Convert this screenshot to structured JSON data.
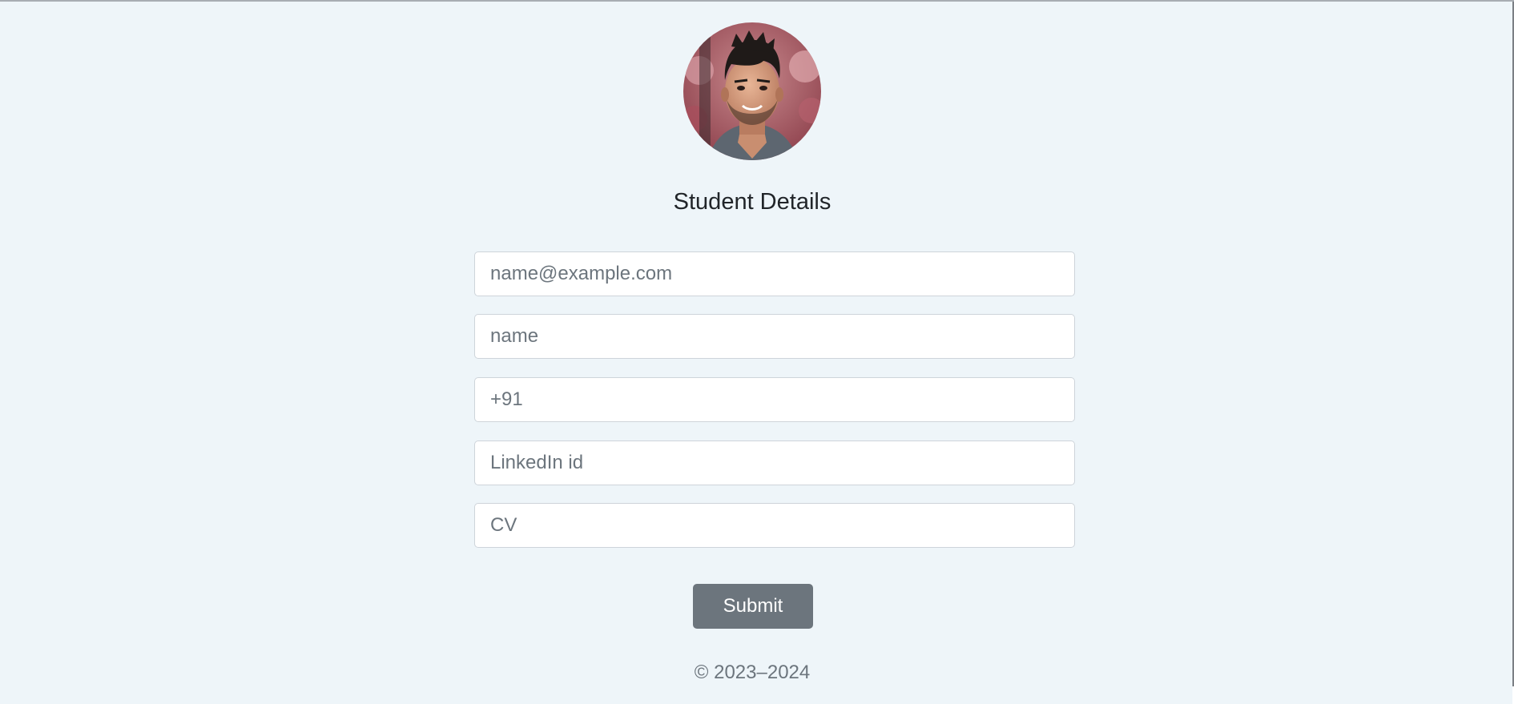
{
  "form": {
    "title": "Student Details",
    "fields": [
      {
        "name": "email",
        "placeholder": "name@example.com",
        "value": ""
      },
      {
        "name": "name",
        "placeholder": "name",
        "value": ""
      },
      {
        "name": "phone",
        "placeholder": "+91",
        "value": ""
      },
      {
        "name": "linkedin",
        "placeholder": "LinkedIn id",
        "value": ""
      },
      {
        "name": "cv",
        "placeholder": "CV",
        "value": ""
      }
    ],
    "submit_label": "Submit"
  },
  "footer": {
    "copyright": "© 2023–2024"
  },
  "colors": {
    "page_background": "#eef5f9",
    "submit_button": "#6c757d",
    "input_border": "#ced4da",
    "placeholder_text": "#6c757d"
  },
  "icons": {
    "avatar": "profile-photo"
  }
}
